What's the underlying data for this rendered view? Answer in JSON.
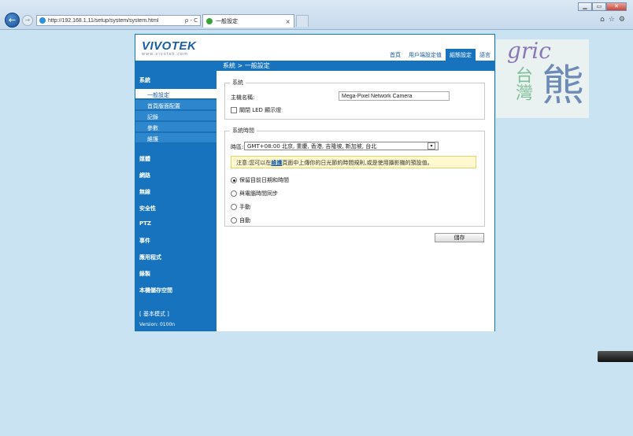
{
  "browser": {
    "url": "http://192.168.1.11/setup/system/system.html",
    "addr_controls": "ρ - C",
    "tab_title": "一般設定",
    "close_tab": "×",
    "window_buttons": [
      "▁",
      "▭",
      "✕"
    ],
    "right_icons": [
      "⌂",
      "☆",
      "⚙"
    ]
  },
  "logo": {
    "brand": "VIVOTEK",
    "sub": "www.vivotek.com"
  },
  "topnav": [
    {
      "label": "首頁",
      "active": false
    },
    {
      "label": "用戶端設定值",
      "active": false
    },
    {
      "label": "組態設定",
      "active": true
    },
    {
      "label": "語言",
      "active": false
    }
  ],
  "breadcrumb": "系統 > 一般設定",
  "sidebar": {
    "section": "系統",
    "subitems": [
      {
        "label": "一般設定",
        "active": true
      },
      {
        "label": "首頁版面配置",
        "active": false
      },
      {
        "label": "記錄",
        "active": false
      },
      {
        "label": "參數",
        "active": false
      },
      {
        "label": "維護",
        "active": false
      }
    ],
    "items": [
      "媒體",
      "網路",
      "無線",
      "安全性",
      "PTZ",
      "事件",
      "應用程式",
      "錄製",
      "本機儲存空間"
    ],
    "mode": "[ 基本模式 ]",
    "version": "Version: 0100n"
  },
  "system_box": {
    "legend": "系統",
    "host_label": "主機名稱:",
    "host_value": "Mega-Pixel Network Camera",
    "led_label": "關閉 LED 顯示燈",
    "led_checked": false
  },
  "time_box": {
    "legend": "系統時間",
    "tz_label": "時區:",
    "tz_value": "GMT+08:00 北京, 重慶, 香港, 吉隆坡, 新加坡, 台北",
    "tz_arrow": "▾",
    "note_prefix": "注意:您可以在",
    "note_link": "維護",
    "note_suffix": "頁面中上傳你的日光節約時間規則,或是使用攝影機的預設值。",
    "options": [
      {
        "label": "保留目前日期和時間",
        "selected": true
      },
      {
        "label": "與電腦時間同步",
        "selected": false
      },
      {
        "label": "手動",
        "selected": false
      },
      {
        "label": "自動",
        "selected": false
      }
    ]
  },
  "save_label": "儲存",
  "watermark": {
    "latin": "gric",
    "cjk_small": "台灣",
    "cjk_large": "熊"
  },
  "colors": {
    "accent": "#1873bf",
    "background": "#c9e3f3",
    "note_bg": "#fff8d0"
  }
}
